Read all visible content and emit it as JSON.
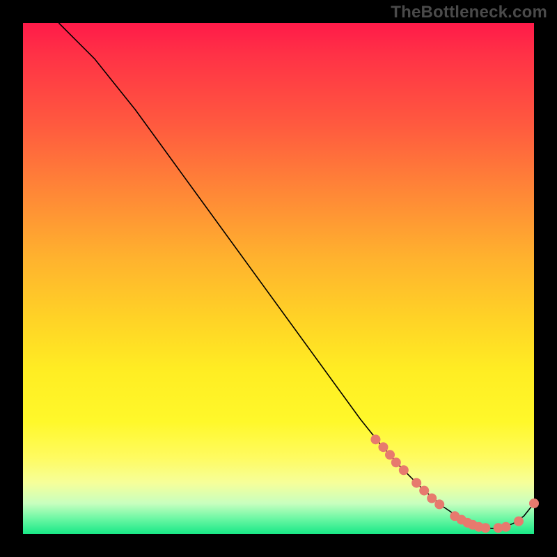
{
  "attribution": "TheBottleneck.com",
  "chart_data": {
    "type": "line",
    "title": "",
    "xlabel": "",
    "ylabel": "",
    "xlim": [
      0,
      100
    ],
    "ylim": [
      0,
      100
    ],
    "grid": false,
    "legend": false,
    "notes": "Background is a vertical red→yellow→green gradient. A single black curve starts near (7,100), descends roughly linearly to a minimum around (90,1), then rises slightly toward (100,6). Salmon-colored circular markers highlight a subset of points on the lower-right portion of the curve.",
    "series": [
      {
        "name": "curve",
        "x": [
          7,
          10,
          14,
          18,
          22,
          26,
          30,
          34,
          38,
          42,
          46,
          50,
          54,
          58,
          62,
          66,
          70,
          74,
          78,
          82,
          86,
          90,
          92,
          94,
          96,
          98,
          100
        ],
        "y": [
          100,
          97,
          93,
          88,
          83,
          77.5,
          72,
          66.5,
          61,
          55.5,
          50,
          44.5,
          39,
          33.5,
          28,
          22.5,
          17.5,
          13,
          9,
          5.5,
          2.8,
          1.2,
          1.1,
          1.3,
          2.1,
          3.5,
          6
        ]
      }
    ],
    "markers": {
      "color": "#e77a6e",
      "radius_px": 7,
      "points": [
        {
          "x": 69,
          "y": 18.5
        },
        {
          "x": 70.5,
          "y": 17
        },
        {
          "x": 71.8,
          "y": 15.5
        },
        {
          "x": 73,
          "y": 14
        },
        {
          "x": 74.5,
          "y": 12.5
        },
        {
          "x": 77,
          "y": 10
        },
        {
          "x": 78.5,
          "y": 8.5
        },
        {
          "x": 80,
          "y": 7
        },
        {
          "x": 81.5,
          "y": 5.8
        },
        {
          "x": 84.5,
          "y": 3.5
        },
        {
          "x": 85.8,
          "y": 2.8
        },
        {
          "x": 87,
          "y": 2.2
        },
        {
          "x": 88,
          "y": 1.8
        },
        {
          "x": 89.2,
          "y": 1.4
        },
        {
          "x": 90.5,
          "y": 1.2
        },
        {
          "x": 93,
          "y": 1.2
        },
        {
          "x": 94.5,
          "y": 1.4
        },
        {
          "x": 97,
          "y": 2.5
        },
        {
          "x": 100,
          "y": 6
        }
      ]
    }
  }
}
